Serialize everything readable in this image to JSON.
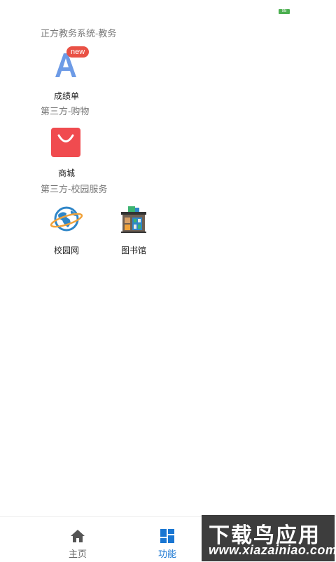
{
  "status_bar": {
    "battery_text": "98"
  },
  "sections": [
    {
      "title": "正方教务系统-教务",
      "items": [
        {
          "label": "成绩单",
          "icon": "grade-a-icon",
          "badge": "new"
        }
      ]
    },
    {
      "title": "第三方-购物",
      "items": [
        {
          "label": "商城",
          "icon": "shopping-bag-icon"
        }
      ]
    },
    {
      "title": "第三方-校园服务",
      "items": [
        {
          "label": "校园网",
          "icon": "globe-icon"
        },
        {
          "label": "图书馆",
          "icon": "library-icon"
        }
      ]
    }
  ],
  "bottom_nav": [
    {
      "label": "主页",
      "icon": "home-icon",
      "active": false
    },
    {
      "label": "功能",
      "icon": "grid-icon",
      "active": true
    }
  ],
  "watermark": {
    "title": "下载鸟应用",
    "url": "www.xiazainiao.com"
  },
  "colors": {
    "accent": "#1976d2",
    "badge": "#e95145",
    "shop": "#f04b4f",
    "text_muted": "#777777"
  }
}
